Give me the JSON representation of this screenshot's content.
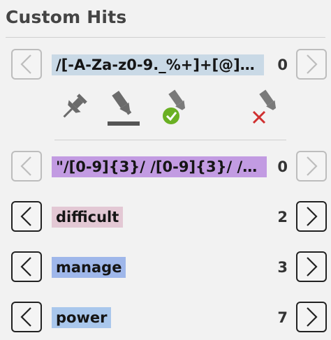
{
  "panel": {
    "title": "Custom Hits"
  },
  "colors": {
    "regex_email_bg": "#c9d9e6",
    "regex_phone_bg": "#c29be2",
    "difficult_bg": "#e3c8d4",
    "manage_bg": "#9fb7ea",
    "power_bg": "#a9c7ec",
    "accent_check": "#6ab023",
    "accent_cross": "#d03030",
    "icon_gray": "#6b6b6b"
  },
  "toolbar": {
    "icons": [
      "pin-icon",
      "highlighter-icon",
      "highlighter-check-icon",
      "highlighter-remove-icon"
    ]
  },
  "hits": [
    {
      "term": "/[-A-Za-z0-9._%+]+[@][-A-...",
      "count": "0",
      "prev_enabled": false,
      "next_enabled": false
    },
    {
      "term": "\"/[0-9]{3}/ /[0-9]{3}/ /[0-9...",
      "count": "0",
      "prev_enabled": false,
      "next_enabled": false
    },
    {
      "term": "difficult",
      "count": "2",
      "prev_enabled": true,
      "next_enabled": true
    },
    {
      "term": "manage",
      "count": "3",
      "prev_enabled": true,
      "next_enabled": true
    },
    {
      "term": "power",
      "count": "7",
      "prev_enabled": true,
      "next_enabled": true
    }
  ]
}
